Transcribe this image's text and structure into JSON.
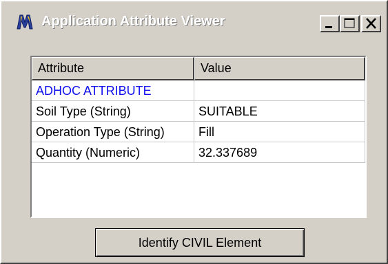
{
  "window": {
    "title": "Application Attribute Viewer"
  },
  "controls": {
    "minimize": "minimize-icon",
    "maximize": "maximize-icon",
    "close": "close-icon"
  },
  "table": {
    "columns": [
      "Attribute",
      "Value"
    ],
    "rows": [
      {
        "attribute": "ADHOC ATTRIBUTE",
        "value": ""
      },
      {
        "attribute": "Soil Type (String)",
        "value": "SUITABLE"
      },
      {
        "attribute": "Operation Type (String)",
        "value": "Fill"
      },
      {
        "attribute": "Quantity (Numeric)",
        "value": "32.337689"
      }
    ],
    "heading_color": "#1111ee"
  },
  "actions": {
    "identify_label": "Identify CIVIL Element"
  }
}
